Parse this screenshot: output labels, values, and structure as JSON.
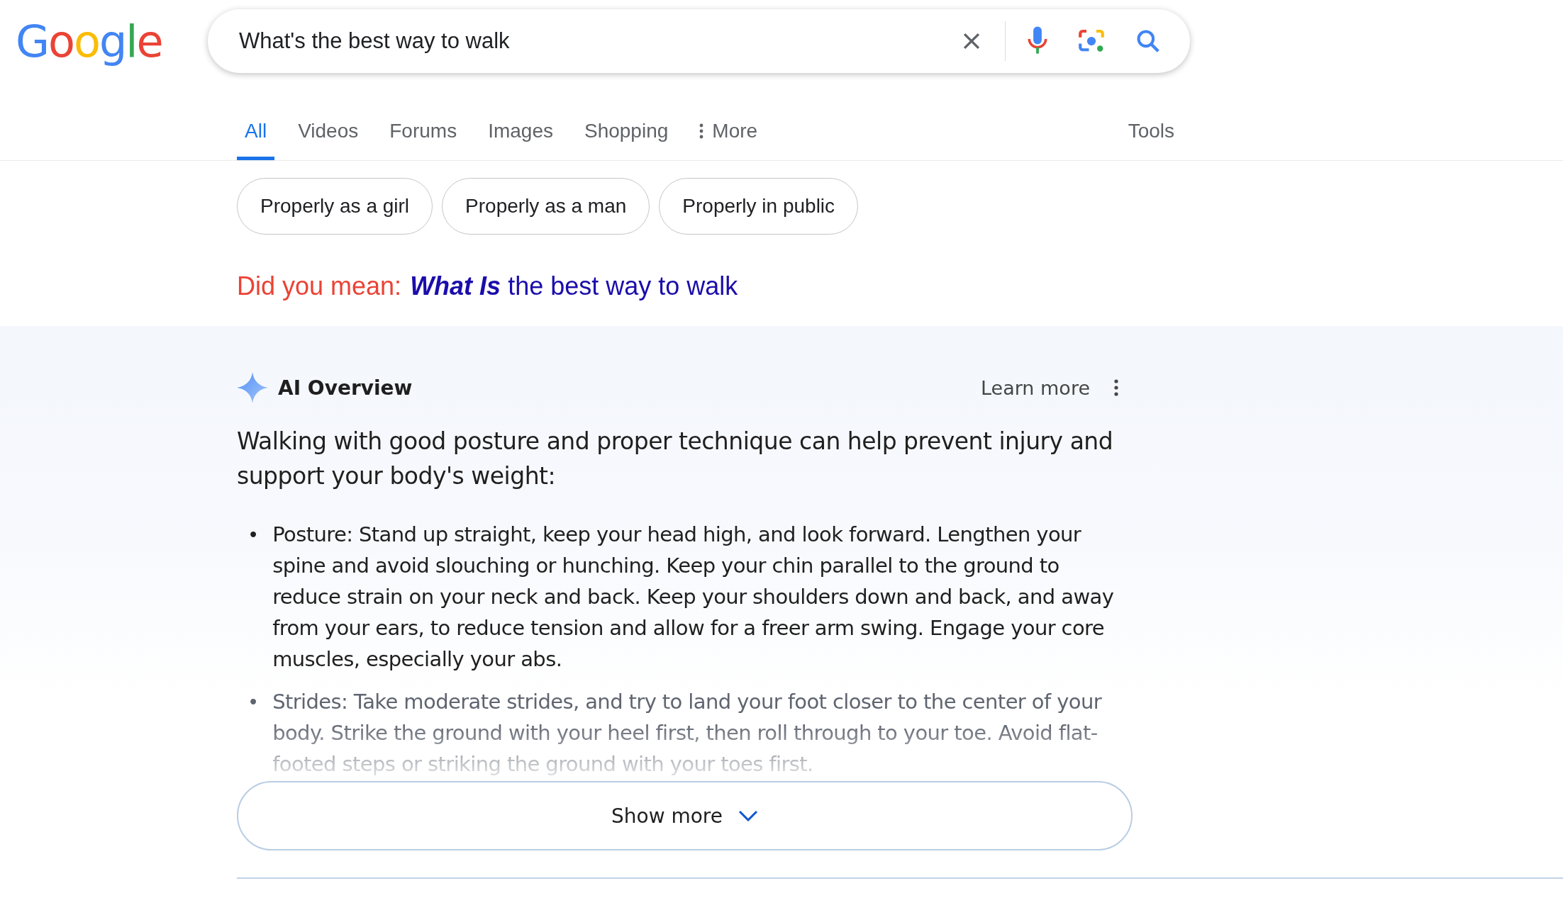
{
  "logo": "Google",
  "search": {
    "value": "What's the best way to walk"
  },
  "tabs": [
    {
      "label": "All",
      "selected": true
    },
    {
      "label": "Videos",
      "selected": false
    },
    {
      "label": "Forums",
      "selected": false
    },
    {
      "label": "Images",
      "selected": false
    },
    {
      "label": "Shopping",
      "selected": false
    },
    {
      "label": "More",
      "selected": false,
      "kind": "menu"
    }
  ],
  "tools": "Tools",
  "chips": [
    "Properly as a girl",
    "Properly as a man",
    "Properly in public"
  ],
  "did_you_mean": {
    "prompt": "Did you mean:",
    "emphasis": "What Is",
    "rest": " the best way to walk"
  },
  "ai_overview": {
    "title": "AI Overview",
    "learn_more": "Learn more",
    "summary": "Walking with good posture and proper technique can help prevent injury and support your body's weight:",
    "bullets": [
      {
        "marker": "•",
        "text": "Posture: Stand up straight, keep your head high, and look forward. Lengthen your spine and avoid slouching or hunching. Keep your chin parallel to the ground to reduce strain on your neck and back. Keep your shoulders down and back, and away from your ears, to reduce tension and allow for a freer arm swing. Engage your core muscles, especially your abs.",
        "faded": false
      },
      {
        "marker": "•",
        "text": "Strides: Take moderate strides, and try to land your foot closer to the center of your body. Strike the ground with your heel first, then roll through to your toe. Avoid flat-footed steps or striking the ground with your toes first.",
        "faded": true
      }
    ],
    "show_more": "Show more"
  }
}
